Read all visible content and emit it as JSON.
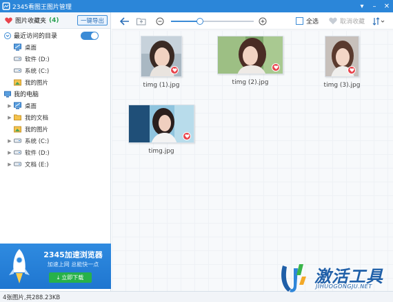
{
  "window": {
    "title": "2345看图王图片管理",
    "buttons": [
      "dropdown-icon",
      "minimize-icon",
      "close-icon"
    ]
  },
  "sidebar": {
    "favorites": {
      "label": "图片收藏夹",
      "count": "(4)",
      "export_label": "一键导出"
    },
    "recent": {
      "label": "最近访问的目录",
      "toggle_on": true,
      "items": [
        {
          "label": "桌面",
          "icon": "desktop-icon"
        },
        {
          "label": "软件 (D:)",
          "icon": "drive-icon"
        },
        {
          "label": "系统 (C:)",
          "icon": "drive-icon"
        },
        {
          "label": "我的图片",
          "icon": "pictures-icon"
        }
      ]
    },
    "computer": {
      "label": "我的电脑",
      "items": [
        {
          "label": "桌面",
          "icon": "desktop-icon",
          "expandable": true
        },
        {
          "label": "我的文档",
          "icon": "folder-icon",
          "expandable": true
        },
        {
          "label": "我的图片",
          "icon": "pictures-icon",
          "expandable": false
        },
        {
          "label": "系统 (C:)",
          "icon": "drive-icon",
          "expandable": true
        },
        {
          "label": "软件 (D:)",
          "icon": "drive-icon",
          "expandable": true
        },
        {
          "label": "文档 (E:)",
          "icon": "drive-icon",
          "expandable": true
        }
      ]
    },
    "ad": {
      "title": "2345加速浏览器",
      "subtitle": "加速上网 总能快一点",
      "button": "立即下载"
    }
  },
  "toolbar": {
    "zoom_level": 0.35,
    "select_all": "全选",
    "unfavorite": "取消收藏"
  },
  "images": [
    {
      "name": "timg (1).jpg",
      "favorited": true
    },
    {
      "name": "timg (2).jpg",
      "favorited": true
    },
    {
      "name": "timg (3).jpg",
      "favorited": true
    },
    {
      "name": "timg.jpg",
      "favorited": true
    }
  ],
  "status": {
    "text": "4张图片,共288.23KB"
  },
  "watermark": {
    "text": "激活工具",
    "url": "JIHUOGONGJU.NET"
  },
  "colors": {
    "titlebar": "#2b86d9",
    "accent": "#3b8bd6",
    "heart": "#e8434b",
    "download": "#27b14a"
  }
}
